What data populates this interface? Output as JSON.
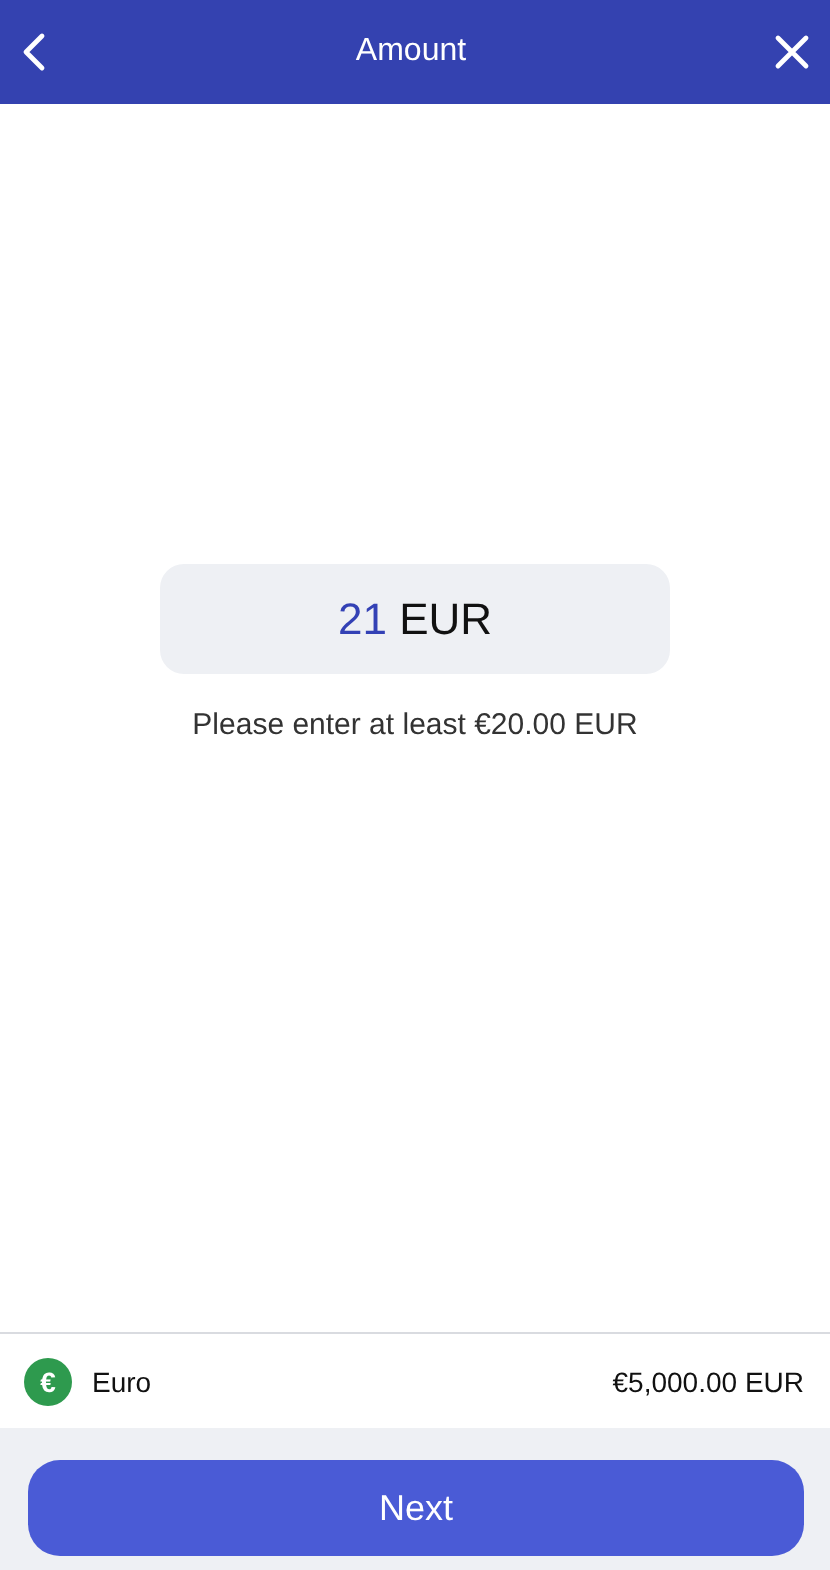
{
  "header": {
    "title": "Amount"
  },
  "amount": {
    "value": "21",
    "currency": "EUR"
  },
  "hint": "Please enter at least €20.00 EUR",
  "account": {
    "symbol": "€",
    "name": "Euro",
    "balance": "€5,000.00 EUR"
  },
  "button": {
    "label": "Next"
  }
}
